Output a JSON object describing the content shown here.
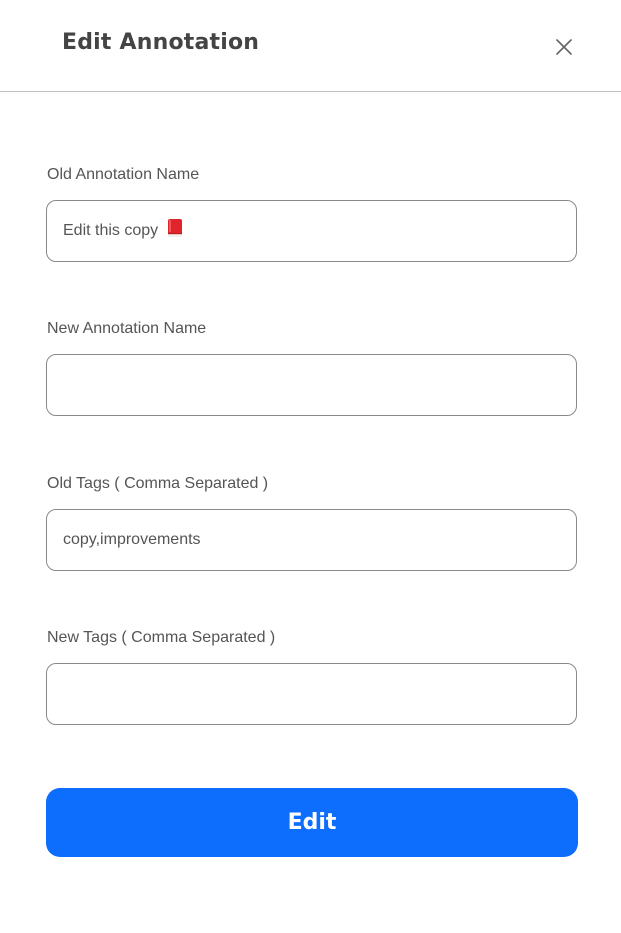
{
  "dialog": {
    "title": "Edit Annotation",
    "close_icon": "close-icon"
  },
  "fields": {
    "old_name": {
      "label": "Old Annotation Name",
      "value": "Edit this copy",
      "icon": "red-book-icon"
    },
    "new_name": {
      "label": "New Annotation Name",
      "value": ""
    },
    "old_tags": {
      "label": "Old Tags ( Comma Separated )",
      "value": "copy,improvements"
    },
    "new_tags": {
      "label": "New Tags ( Comma Separated )",
      "value": ""
    }
  },
  "actions": {
    "submit_label": "Edit",
    "submit_color": "#0d6efd"
  }
}
